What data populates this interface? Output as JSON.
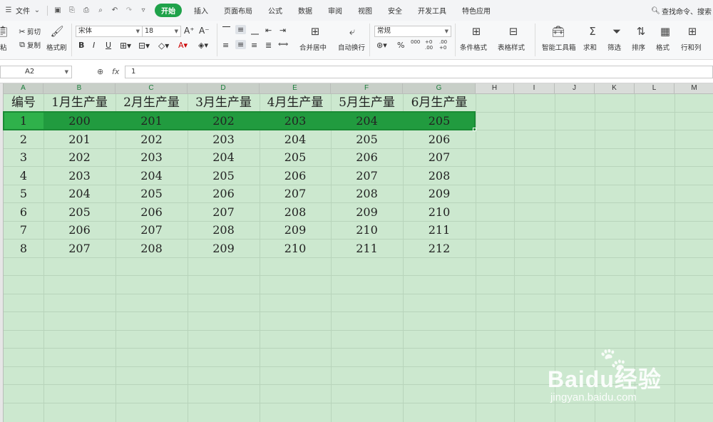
{
  "menu": {
    "file": "文件",
    "tabs": [
      "开始",
      "插入",
      "页面布局",
      "公式",
      "数据",
      "审阅",
      "视图",
      "安全",
      "开发工具",
      "特色应用"
    ],
    "active_tab": "开始",
    "search": "查找命令、搜索"
  },
  "ribbon": {
    "paste": "粘",
    "cut": "剪切",
    "copy": "复制",
    "format_painter": "格式刷",
    "font_name": "宋体",
    "font_size": "18",
    "merge_center": "合并居中",
    "wrap_text": "自动换行",
    "number_format": "常规",
    "conditional_format": "条件格式",
    "table_style": "表格样式",
    "smart_toolbox": "智能工具箱",
    "sum": "求和",
    "filter": "筛选",
    "sort": "排序",
    "format": "格式",
    "row_col": "行和列",
    "percent": "%",
    "thousands": "000",
    "inc_decimal": "+0 .00",
    "dec_decimal": ".00 +0"
  },
  "formula_bar": {
    "name_box": "A2",
    "fx": "fx",
    "value": "1"
  },
  "columns": [
    "A",
    "B",
    "C",
    "D",
    "E",
    "F",
    "G",
    "H",
    "I",
    "J",
    "K",
    "L",
    "M"
  ],
  "table": {
    "headers": [
      "编号",
      "1月生产量",
      "2月生产量",
      "3月生产量",
      "4月生产量",
      "5月生产量",
      "6月生产量"
    ],
    "rows": [
      [
        "1",
        "200",
        "201",
        "202",
        "203",
        "204",
        "205"
      ],
      [
        "2",
        "201",
        "202",
        "203",
        "204",
        "205",
        "206"
      ],
      [
        "3",
        "202",
        "203",
        "204",
        "205",
        "206",
        "207"
      ],
      [
        "4",
        "203",
        "204",
        "205",
        "206",
        "207",
        "208"
      ],
      [
        "5",
        "204",
        "205",
        "206",
        "207",
        "208",
        "209"
      ],
      [
        "6",
        "205",
        "206",
        "207",
        "208",
        "209",
        "210"
      ],
      [
        "7",
        "206",
        "207",
        "208",
        "209",
        "210",
        "211"
      ],
      [
        "8",
        "207",
        "208",
        "209",
        "210",
        "211",
        "212"
      ]
    ],
    "selected_row": 1
  },
  "watermark": {
    "brand": "Baidu经验",
    "url": "jingyan.baidu.com"
  },
  "colors": {
    "accent": "#1fa24a",
    "sheet_bg": "#cce8cf",
    "selection": "#219b3f"
  }
}
